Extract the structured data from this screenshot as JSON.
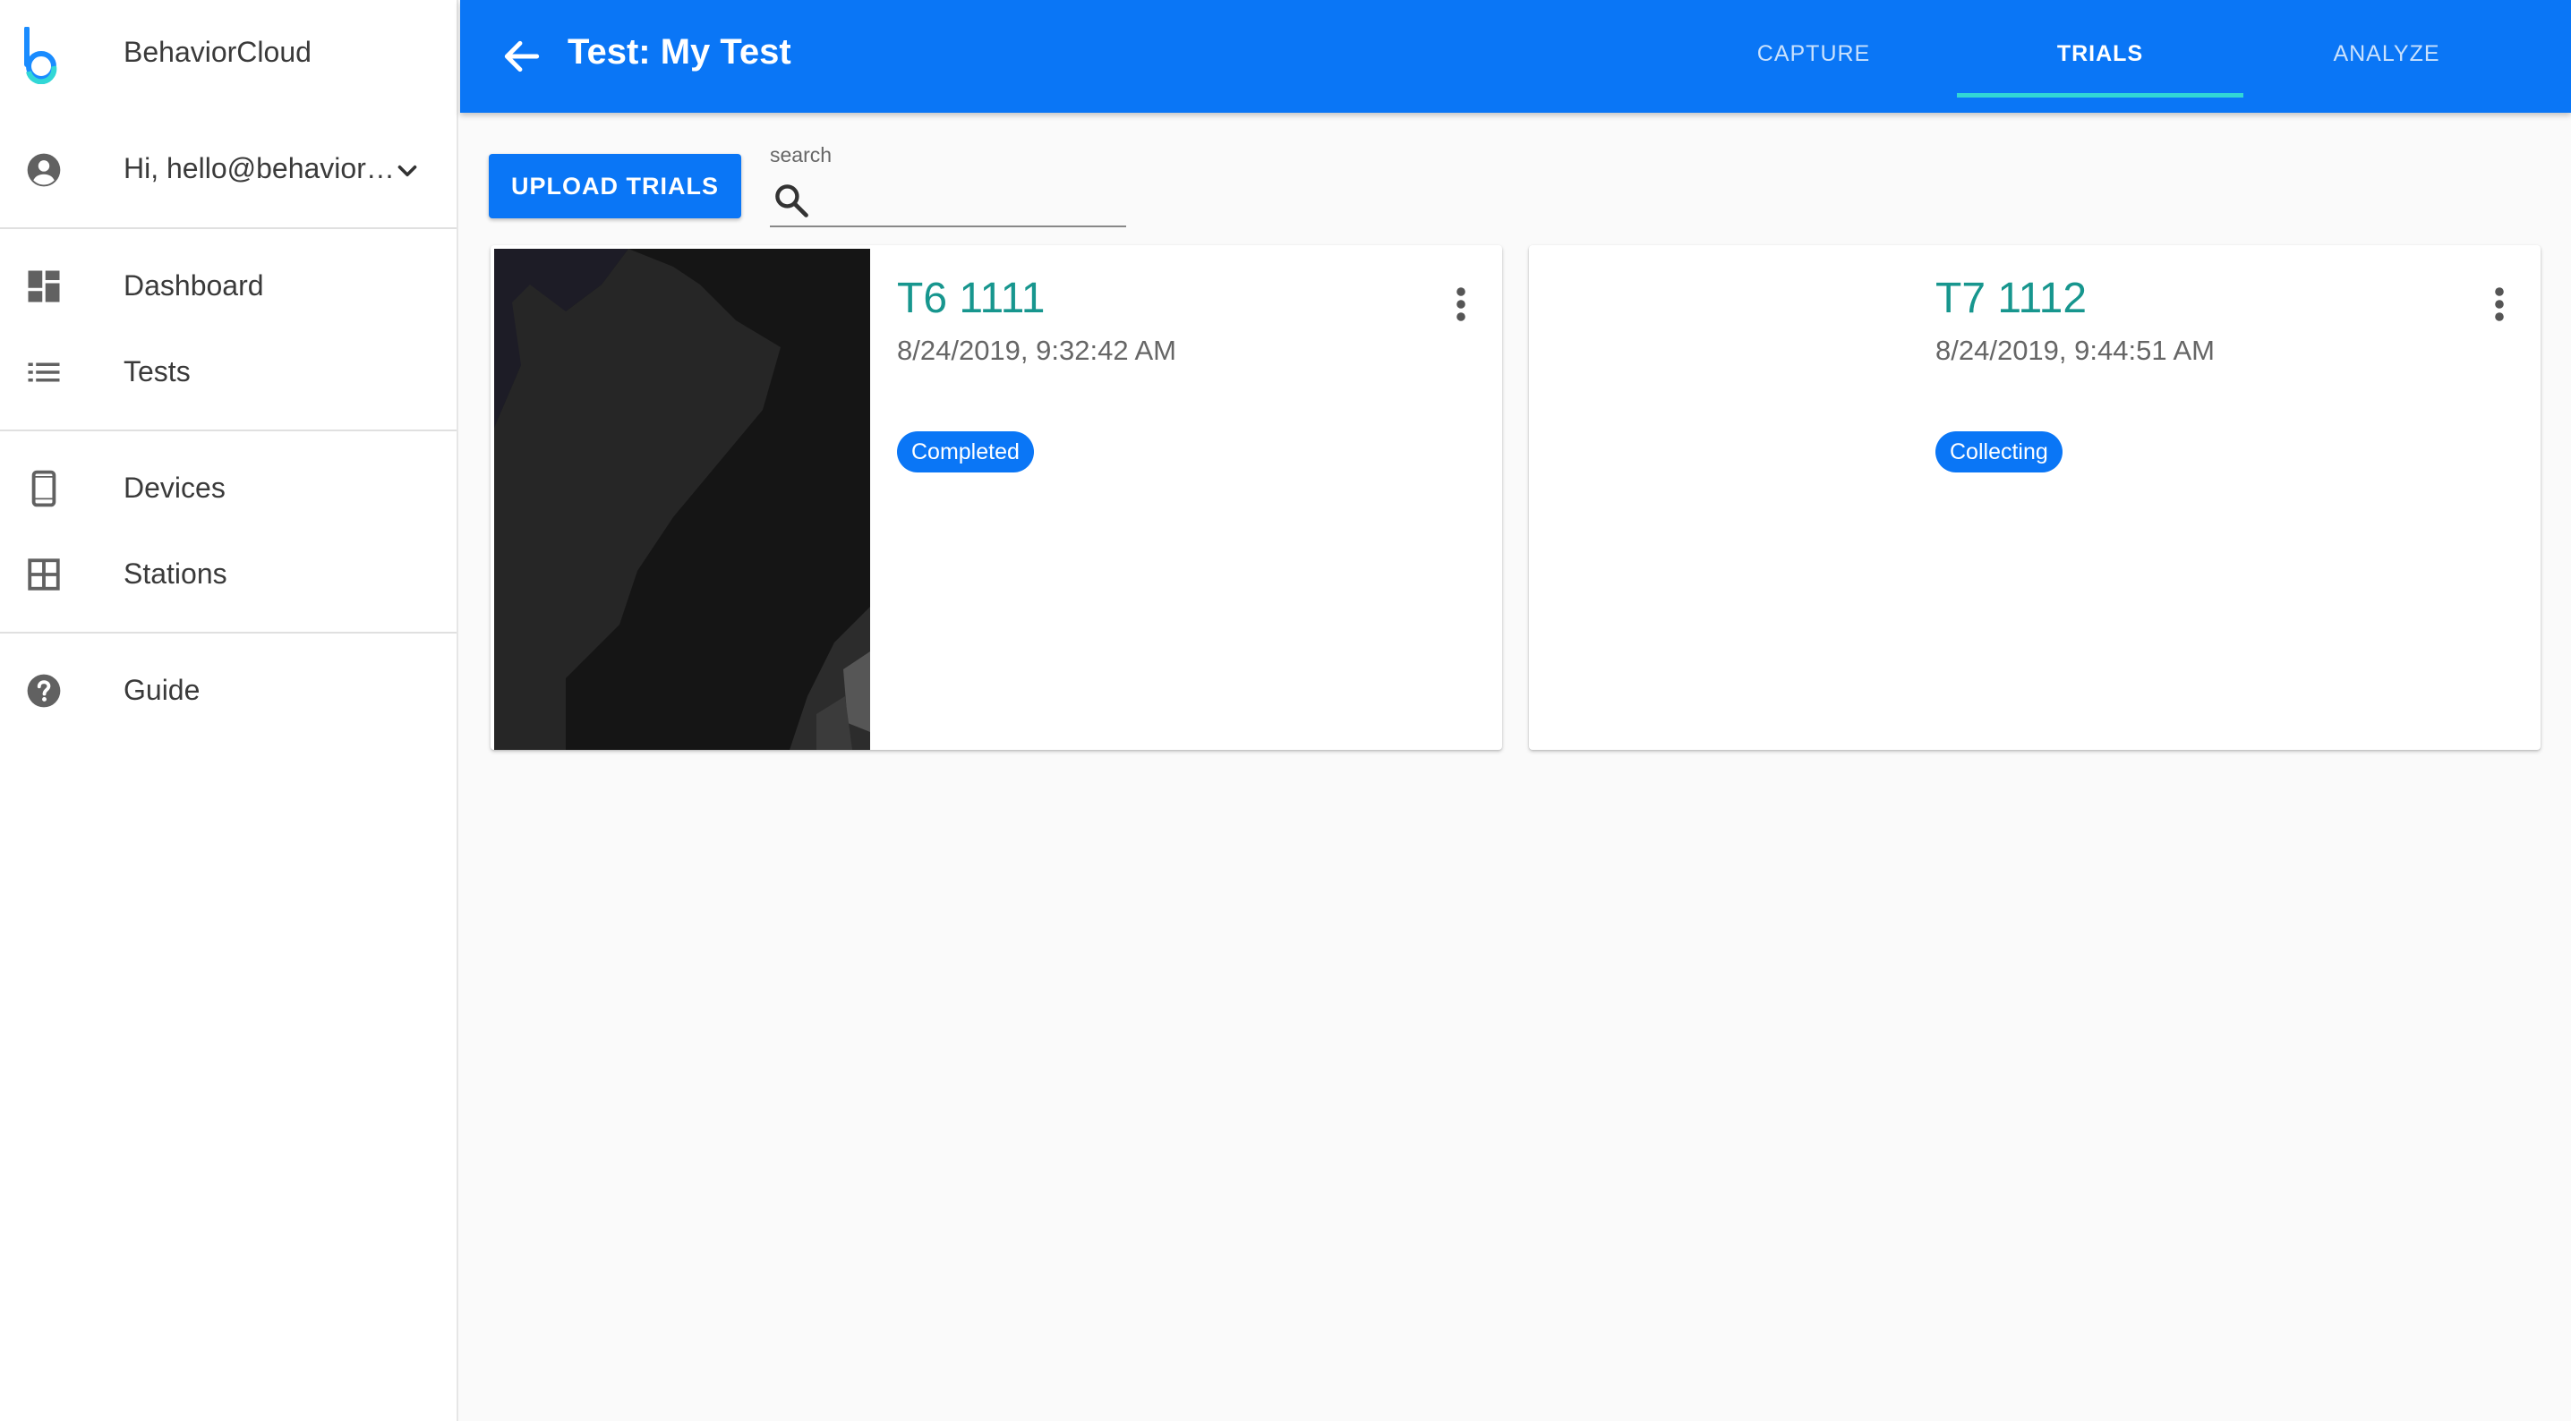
{
  "app": {
    "name": "BehaviorCloud",
    "accent_color": "#0a76f6",
    "title_color": "#17968e",
    "tab_indicator_color": "#31d7d6"
  },
  "sidebar": {
    "user": {
      "label": "Hi, hello@behavior…",
      "icon": "account-circle-icon",
      "toggle_icon": "chevron-down-icon"
    },
    "items": [
      {
        "label": "Dashboard",
        "icon": "dashboard-icon"
      },
      {
        "label": "Tests",
        "icon": "list-icon"
      },
      {
        "label": "Devices",
        "icon": "phone-device-icon"
      },
      {
        "label": "Stations",
        "icon": "grid-icon"
      },
      {
        "label": "Guide",
        "icon": "help-circle-icon"
      }
    ]
  },
  "header": {
    "title": "Test: My Test",
    "back_icon": "arrow-back-icon",
    "tabs": [
      {
        "label": "CAPTURE",
        "active": false
      },
      {
        "label": "TRIALS",
        "active": true
      },
      {
        "label": "ANALYZE",
        "active": false
      }
    ]
  },
  "toolbar": {
    "upload_label": "UPLOAD TRIALS",
    "search_label": "search",
    "search_value": "",
    "search_placeholder": "",
    "search_icon": "search-icon"
  },
  "trials": [
    {
      "name": "T6 1111",
      "datetime": "8/24/2019, 9:32:42 AM",
      "status": "Completed",
      "has_thumbnail": true
    },
    {
      "name": "T7 1112",
      "datetime": "8/24/2019, 9:44:51 AM",
      "status": "Collecting",
      "has_thumbnail": false
    }
  ]
}
